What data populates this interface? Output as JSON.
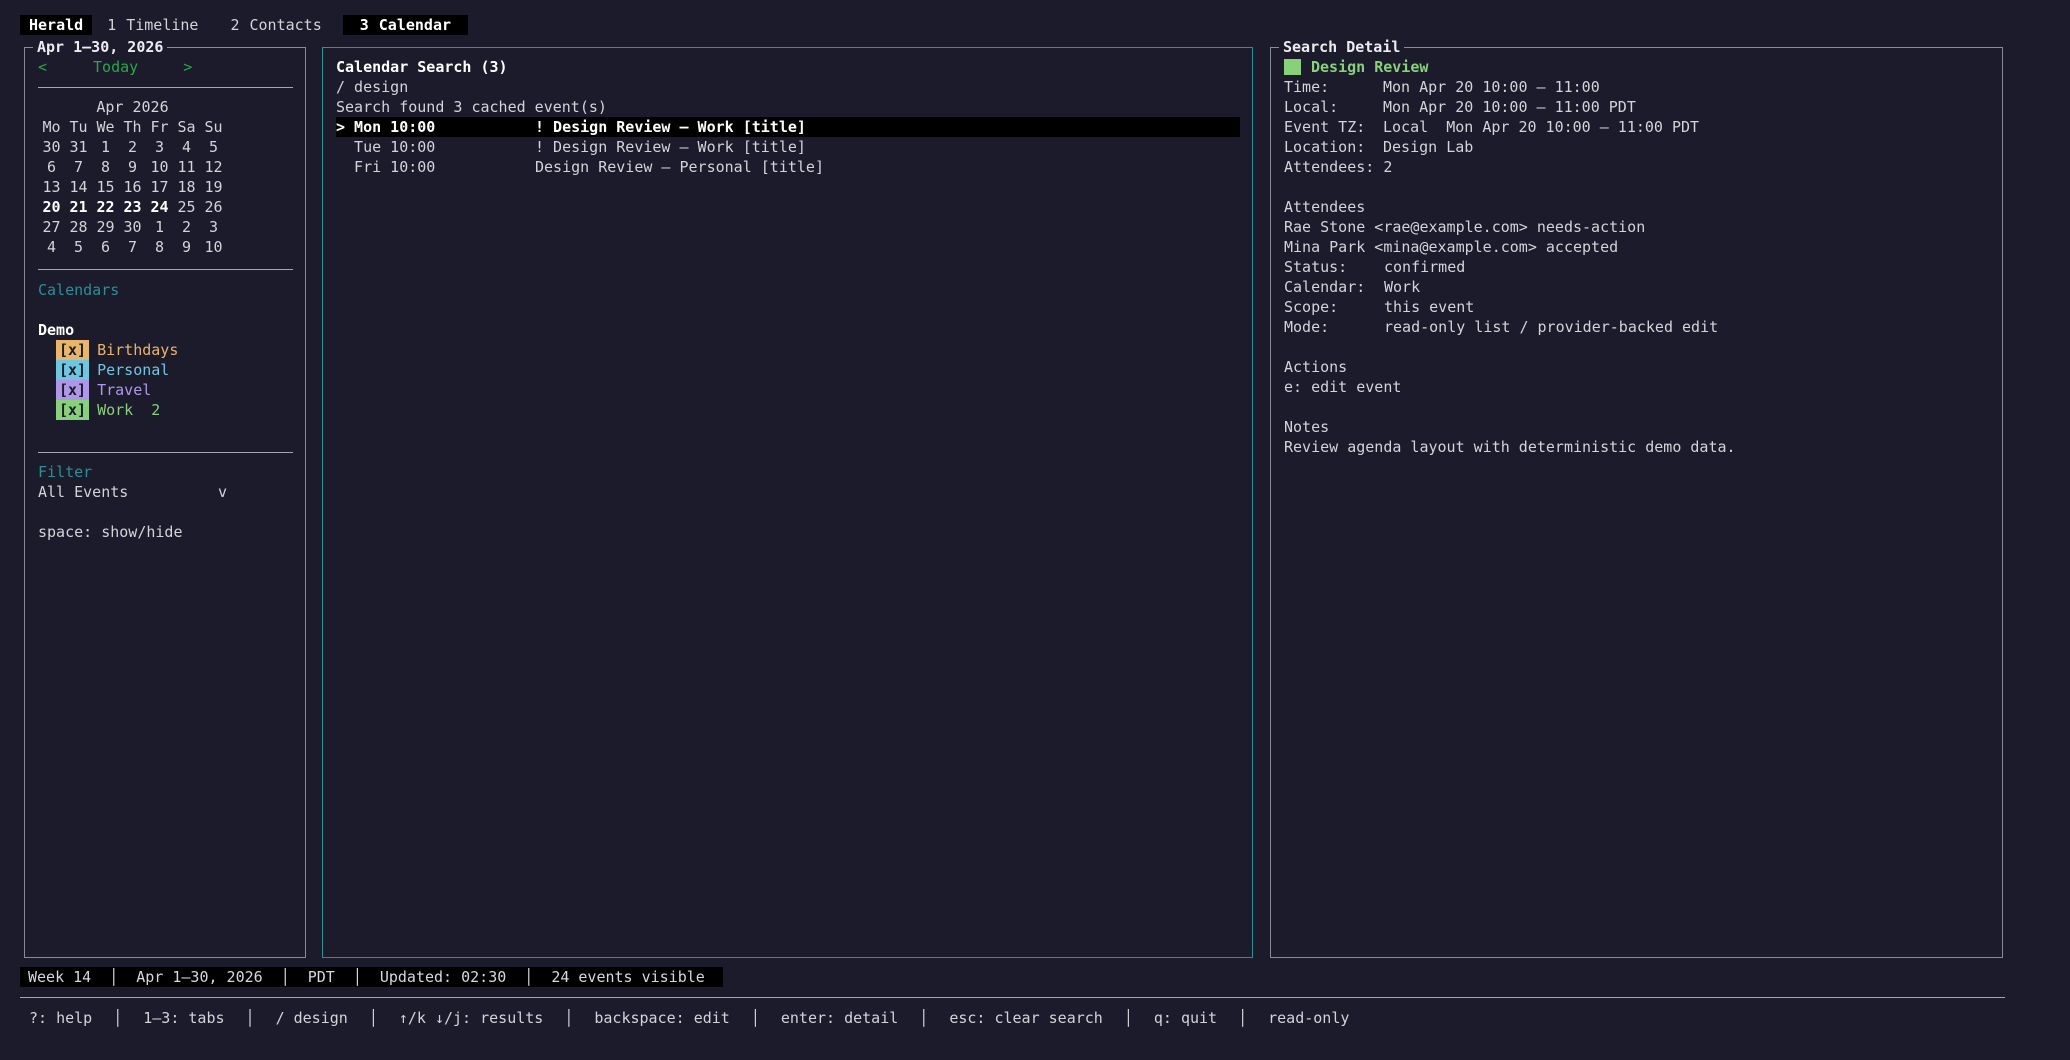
{
  "tabs": {
    "brand": "Herald",
    "items": [
      {
        "num": "1",
        "label": "Timeline"
      },
      {
        "num": "2",
        "label": "Contacts"
      },
      {
        "num": "3",
        "label": "Calendar"
      }
    ]
  },
  "sidebar": {
    "title": "Apr 1–30, 2026",
    "nav_prev": "<",
    "nav_today": "Today",
    "nav_next": ">",
    "month_label": "Apr 2026",
    "weekdays": [
      "Mo",
      "Tu",
      "We",
      "Th",
      "Fr",
      "Sa",
      "Su"
    ],
    "weeks": [
      [
        "30",
        "31",
        "1",
        "2",
        "3",
        "4",
        "5"
      ],
      [
        "6",
        "7",
        "8",
        "9",
        "10",
        "11",
        "12"
      ],
      [
        "13",
        "14",
        "15",
        "16",
        "17",
        "18",
        "19"
      ],
      [
        "20",
        "21",
        "22",
        "23",
        "24",
        "25",
        "26"
      ],
      [
        "27",
        "28",
        "29",
        "30",
        "1",
        "2",
        "3"
      ],
      [
        "4",
        "5",
        "6",
        "7",
        "8",
        "9",
        "10"
      ]
    ],
    "bold_week_cells": [
      "20",
      "21",
      "22",
      "23",
      "24"
    ],
    "calendars_heading": "Calendars",
    "group_label": "Demo",
    "calendars": [
      {
        "check": "[x]",
        "name": "Birthdays",
        "count": "",
        "color": "#e8b56a"
      },
      {
        "check": "[x]",
        "name": "Personal",
        "count": "",
        "color": "#6ec6e0"
      },
      {
        "check": "[x]",
        "name": "Travel",
        "count": "",
        "color": "#b096e8"
      },
      {
        "check": "[x]",
        "name": "Work",
        "count": "2",
        "color": "#88d07a"
      }
    ],
    "filter_heading": "Filter",
    "filter_value": "All Events",
    "filter_caret": "v",
    "hint": "space: show/hide"
  },
  "search": {
    "title": "Calendar Search (3)",
    "query": "/ design",
    "summary": "Search found 3 cached event(s)",
    "results": [
      {
        "marker": ">",
        "time": "Mon 10:00",
        "title": "! Design Review — Work [title]",
        "selected": true
      },
      {
        "marker": " ",
        "time": "Tue 10:00",
        "title": "! Design Review — Work [title]",
        "selected": false
      },
      {
        "marker": " ",
        "time": "Fri 10:00",
        "title": "Design Review — Personal [title]",
        "selected": false
      }
    ]
  },
  "detail": {
    "panel_title": "Search Detail",
    "event_title": "Design Review",
    "event_color": "#88d07a",
    "fields": [
      {
        "label": "Time:",
        "value": "Mon Apr 20 10:00 – 11:00"
      },
      {
        "label": "Local:",
        "value": "Mon Apr 20 10:00 – 11:00 PDT"
      },
      {
        "label": "Event TZ:",
        "value": "Local  Mon Apr 20 10:00 – 11:00 PDT"
      },
      {
        "label": "Location:",
        "value": "Design Lab"
      },
      {
        "label": "Attendees:",
        "value": "2"
      }
    ],
    "attendees_heading": "Attendees",
    "attendees": [
      "Rae Stone <rae@example.com> needs-action",
      "Mina Park <mina@example.com> accepted"
    ],
    "meta": [
      {
        "label": "Status:",
        "value": "confirmed"
      },
      {
        "label": "Calendar:",
        "value": "Work"
      },
      {
        "label": "Scope:",
        "value": "this event"
      },
      {
        "label": "Mode:",
        "value": "read-only list / provider-backed edit"
      }
    ],
    "actions_heading": "Actions",
    "actions": [
      "e: edit event"
    ],
    "notes_heading": "Notes",
    "notes": "Review agenda layout with deterministic demo data."
  },
  "status": [
    "Week 14",
    "Apr 1–30, 2026",
    "PDT",
    "Updated: 02:30",
    "24 events visible"
  ],
  "help": [
    "?: help",
    "1–3: tabs",
    "/ design",
    "↑/k ↓/j: results",
    "backspace: edit",
    "enter: detail",
    "esc: clear search",
    "q: quit",
    "read-only"
  ]
}
